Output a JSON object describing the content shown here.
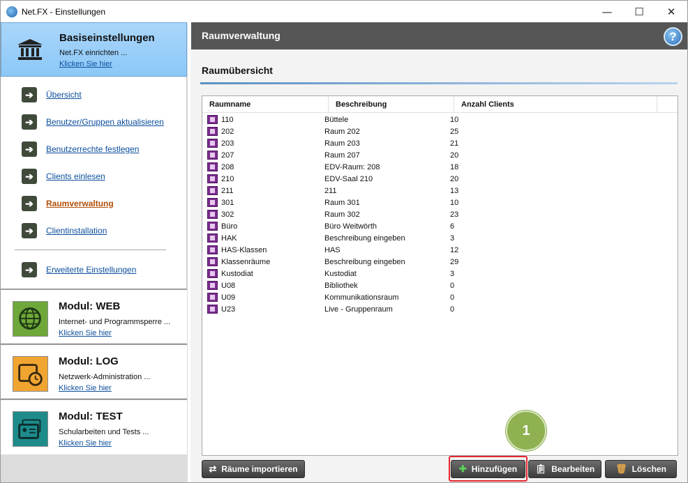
{
  "window": {
    "title": "Net.FX - Einstellungen",
    "minimize": "—",
    "maximize": "☐",
    "close": "✕"
  },
  "sidebar": {
    "basis": {
      "title": "Basiseinstellungen",
      "desc": "Net.FX einrichten ...",
      "link": "Klicken Sie hier"
    },
    "nav": [
      {
        "label": "Übersicht"
      },
      {
        "label": "Benutzer/Gruppen aktualisieren"
      },
      {
        "label": "Benutzerrechte festlegen"
      },
      {
        "label": "Clients einlesen"
      },
      {
        "label": "Raumverwaltung",
        "active": true
      },
      {
        "label": "Clientinstallation"
      },
      {
        "label": "Erweiterte Einstellungen"
      }
    ],
    "modules": [
      {
        "title": "Modul: WEB",
        "desc": "Internet- und Programmsperre ...",
        "link": "Klicken Sie hier",
        "icon": "globe-icon",
        "color": "#6fa83a"
      },
      {
        "title": "Modul: LOG",
        "desc": "Netzwerk-Administration ...",
        "link": "Klicken Sie hier",
        "icon": "folder-clock-icon",
        "color": "#f1a531"
      },
      {
        "title": "Modul: TEST",
        "desc": "Schularbeiten und Tests ...",
        "link": "Klicken Sie hier",
        "icon": "id-cards-icon",
        "color": "#1e8b8b"
      }
    ]
  },
  "main": {
    "header": "Raumverwaltung",
    "help": "?",
    "section_title": "Raumübersicht",
    "columns": [
      "Raumname",
      "Beschreibung",
      "Anzahl Clients"
    ],
    "rows": [
      [
        "110",
        "Büttele",
        "10"
      ],
      [
        "202",
        "Raum 202",
        "25"
      ],
      [
        "203",
        "Raum 203",
        "21"
      ],
      [
        "207",
        "Raum 207",
        "20"
      ],
      [
        "208",
        "EDV-Raum: 208",
        "18"
      ],
      [
        "210",
        "EDV-Saal 210",
        "20"
      ],
      [
        "211",
        "211",
        "13"
      ],
      [
        "301",
        "Raum 301",
        "10"
      ],
      [
        "302",
        "Raum 302",
        "23"
      ],
      [
        "Büro",
        "Büro Weitwörth",
        "6"
      ],
      [
        "HAK",
        "Beschreibung eingeben",
        "3"
      ],
      [
        "HAS-Klassen",
        "HAS",
        "12"
      ],
      [
        "Klassenräume",
        "Beschreibung eingeben",
        "29"
      ],
      [
        "Kustodiat",
        "Kustodiat",
        "3"
      ],
      [
        "U08",
        "Bibliothek",
        "0"
      ],
      [
        "U09",
        "Kommunikationsraum",
        "0"
      ],
      [
        "U23",
        "Live - Gruppenraum",
        "0"
      ]
    ],
    "buttons": {
      "import": "Räume importieren",
      "add": "Hinzufügen",
      "edit": "Bearbeiten",
      "delete": "Löschen"
    },
    "badge": "1"
  }
}
